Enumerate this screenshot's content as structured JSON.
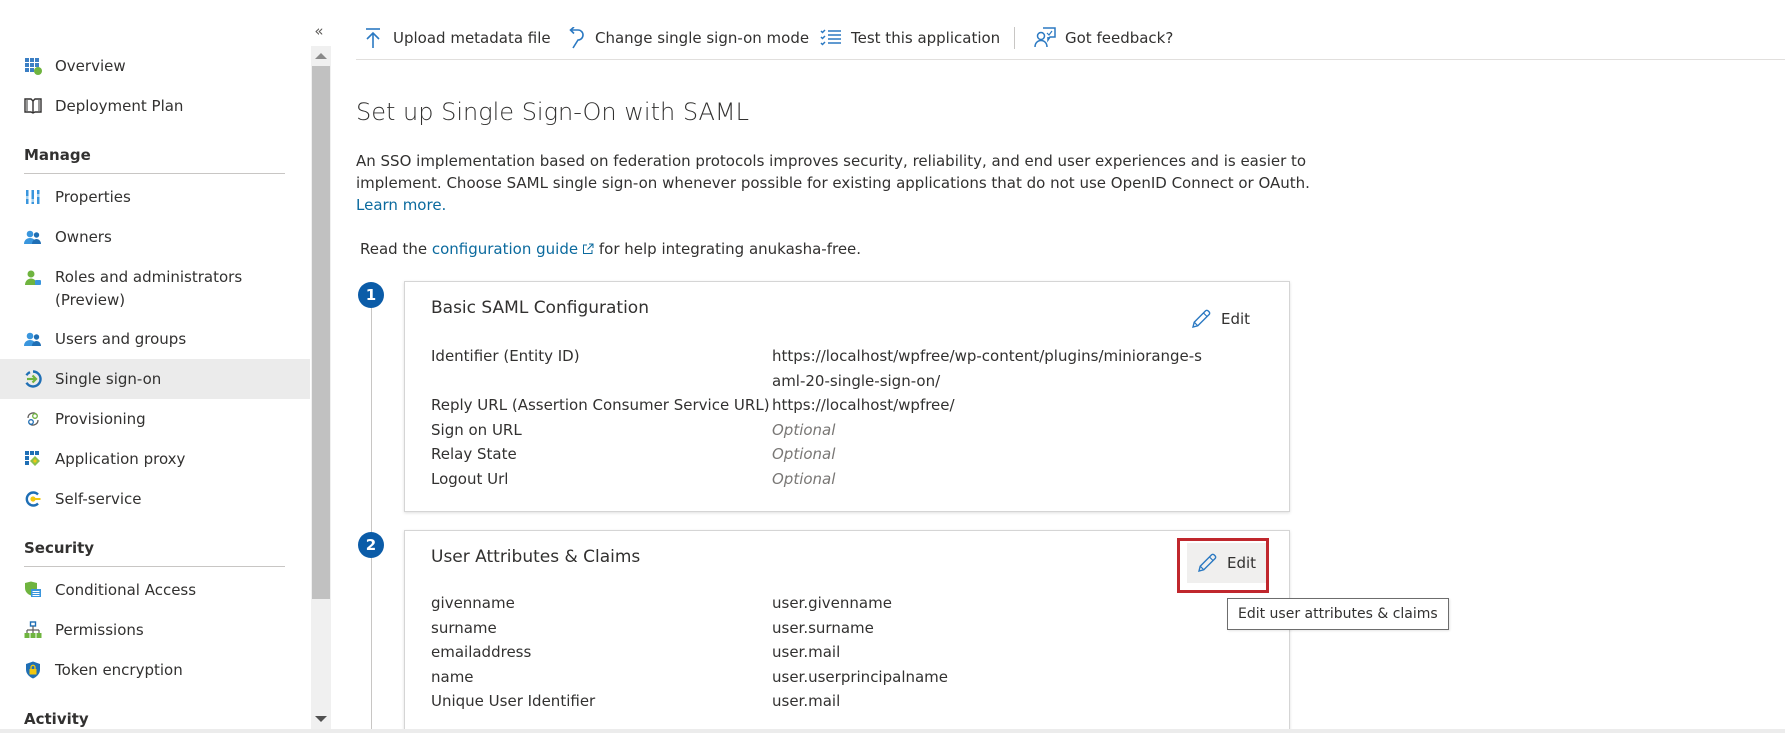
{
  "sidebar": {
    "collapse_icon": "double-chevron-left-icon",
    "collapse_glyph": "«",
    "items_top": [
      {
        "label": "Overview",
        "icon": "overview-grid-icon"
      },
      {
        "label": "Deployment Plan",
        "icon": "book-icon"
      }
    ],
    "sections": [
      {
        "title": "Manage",
        "items": [
          {
            "label": "Properties",
            "icon": "properties-icon"
          },
          {
            "label": "Owners",
            "icon": "owners-icon"
          },
          {
            "label": "Roles and administrators (Preview)",
            "icon": "roles-icon"
          },
          {
            "label": "Users and groups",
            "icon": "users-groups-icon"
          },
          {
            "label": "Single sign-on",
            "icon": "single-sign-on-icon",
            "active": true
          },
          {
            "label": "Provisioning",
            "icon": "provisioning-icon"
          },
          {
            "label": "Application proxy",
            "icon": "application-proxy-icon"
          },
          {
            "label": "Self-service",
            "icon": "self-service-icon"
          }
        ]
      },
      {
        "title": "Security",
        "items": [
          {
            "label": "Conditional Access",
            "icon": "conditional-access-icon"
          },
          {
            "label": "Permissions",
            "icon": "permissions-icon"
          },
          {
            "label": "Token encryption",
            "icon": "token-encryption-icon"
          }
        ]
      },
      {
        "title": "Activity",
        "items": []
      }
    ]
  },
  "toolbar": {
    "upload": {
      "label": "Upload metadata file",
      "icon": "upload-icon"
    },
    "change_mode": {
      "label": "Change single sign-on mode",
      "icon": "undo-icon"
    },
    "test": {
      "label": "Test this application",
      "icon": "checklist-icon"
    },
    "feedback": {
      "label": "Got feedback?",
      "icon": "feedback-icon"
    }
  },
  "main": {
    "title": "Set up Single Sign-On with SAML",
    "description": "An SSO implementation based on federation protocols improves security, reliability, and end user experiences and is easier to implement. Choose SAML single sign-on whenever possible for existing applications that do not use OpenID Connect or OAuth.",
    "learn_more": "Learn more.",
    "guide_prefix": "Read the",
    "guide_link": "configuration guide",
    "guide_suffix": "for help integrating anukasha-free.",
    "steps": [
      {
        "number": "1",
        "title": "Basic SAML Configuration",
        "edit_label": "Edit",
        "rows": [
          {
            "key": "Identifier (Entity ID)",
            "value": "https://localhost/wpfree/wp-content/plugins/miniorange-saml-20-single-sign-on/",
            "optional": false
          },
          {
            "key": "Reply URL (Assertion Consumer Service URL)",
            "value": "https://localhost/wpfree/",
            "optional": false
          },
          {
            "key": "Sign on URL",
            "value": "Optional",
            "optional": true
          },
          {
            "key": "Relay State",
            "value": "Optional",
            "optional": true
          },
          {
            "key": "Logout Url",
            "value": "Optional",
            "optional": true
          }
        ]
      },
      {
        "number": "2",
        "title": "User Attributes & Claims",
        "edit_label": "Edit",
        "edit_tooltip": "Edit user attributes & claims",
        "rows": [
          {
            "key": "givenname",
            "value": "user.givenname"
          },
          {
            "key": "surname",
            "value": "user.surname"
          },
          {
            "key": "emailaddress",
            "value": "user.mail"
          },
          {
            "key": "name",
            "value": "user.userprincipalname"
          },
          {
            "key": "Unique User Identifier",
            "value": "user.mail"
          }
        ]
      }
    ]
  },
  "colors": {
    "accent": "#0b5ca8",
    "link": "#0b6a9e",
    "highlight_box": "#c0272d",
    "active_nav_bg": "#ebebeb"
  }
}
